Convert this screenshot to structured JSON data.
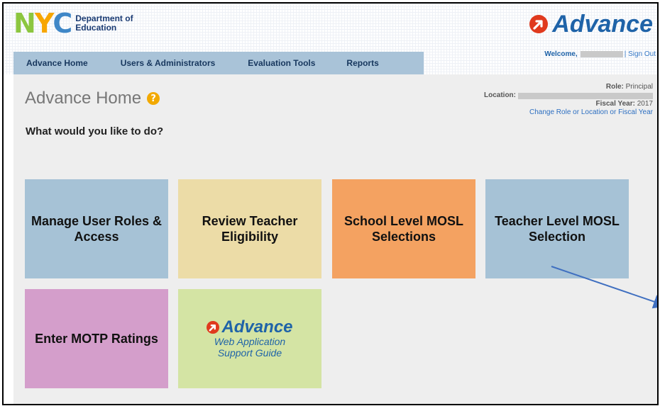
{
  "header": {
    "org_logo_text": "NYC",
    "org_dept_line1": "Department of",
    "org_dept_line2": "Education",
    "brand_name": "Advance",
    "welcome_label": "Welcome,",
    "sign_out_label": "| Sign Out"
  },
  "nav": {
    "items": [
      {
        "label": "Advance Home"
      },
      {
        "label": "Users & Administrators"
      },
      {
        "label": "Evaluation Tools"
      },
      {
        "label": "Reports"
      }
    ]
  },
  "main": {
    "title": "Advance Home",
    "help_icon": "?",
    "prompt": "What would you like to do?"
  },
  "context": {
    "role_label": "Role:",
    "role_value": "Principal",
    "location_label": "Location:",
    "fiscal_year_label": "Fiscal Year:",
    "fiscal_year_value": "2017",
    "change_link": "Change Role or Location or Fiscal Year"
  },
  "tiles": [
    {
      "label": "Manage User Roles & Access",
      "color": "#a6c2d6"
    },
    {
      "label": "Review Teacher Eligibility",
      "color": "#ecdca7"
    },
    {
      "label": "School Level MOSL Selections",
      "color": "#f4a261"
    },
    {
      "label": "Teacher Level MOSL Selection",
      "color": "#a6c2d6"
    },
    {
      "label": "Enter MOTP Ratings",
      "color": "#d49ecb"
    },
    {
      "brand": "Advance",
      "line1": "Web Application",
      "line2": "Support Guide",
      "color": "#d4e4a4"
    }
  ],
  "colors": {
    "nav_bg": "#a9c3d8",
    "brand_blue": "#1f63a8",
    "brand_red": "#e03a1e",
    "annotation_arrow": "#3f6fc0"
  }
}
